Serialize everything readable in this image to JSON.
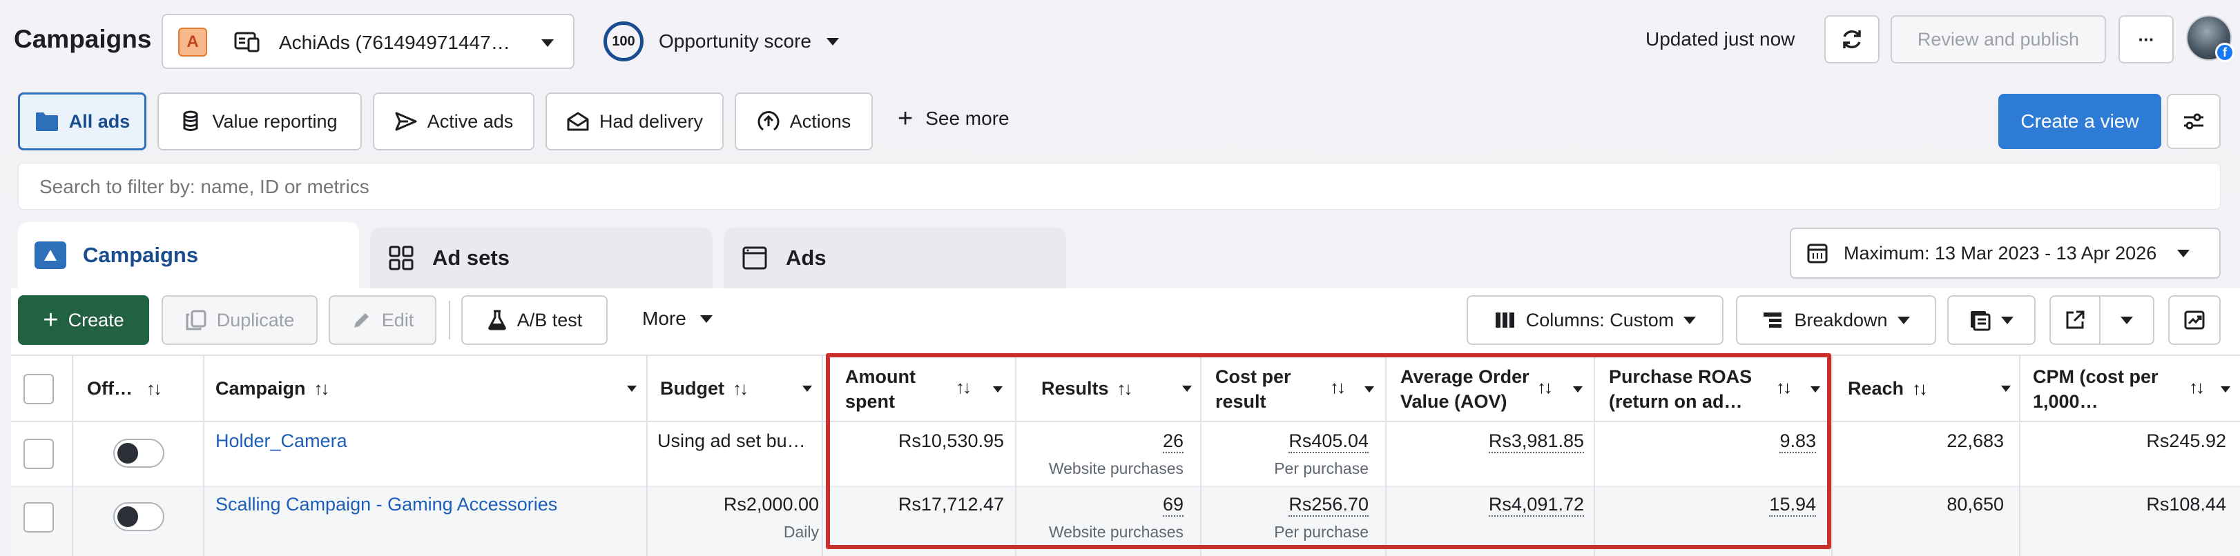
{
  "header": {
    "title": "Campaigns",
    "account_letter": "A",
    "account_name": "AchiAds (761494971447…",
    "opportunity_score": "100",
    "opportunity_label": "Opportunity score",
    "updated": "Updated just now",
    "review_publish": "Review and publish",
    "more": "···"
  },
  "views": {
    "items": [
      "All ads",
      "Value reporting",
      "Active ads",
      "Had delivery",
      "Actions"
    ],
    "see_more": "See more",
    "create_view": "Create a view"
  },
  "search": {
    "placeholder": "Search to filter by: name, ID or metrics"
  },
  "tabs": [
    "Campaigns",
    "Ad sets",
    "Ads"
  ],
  "date_range": "Maximum: 13 Mar 2023 - 13 Apr 2026",
  "toolbar": {
    "create": "Create",
    "duplicate": "Duplicate",
    "edit": "Edit",
    "ab_test": "A/B test",
    "more": "More",
    "columns": "Columns: Custom",
    "breakdown": "Breakdown"
  },
  "table": {
    "headers": {
      "off_on": "Off…",
      "campaign": "Campaign",
      "budget": "Budget",
      "amount_spent": "Amount spent",
      "results": "Results",
      "cost_per_result": "Cost per result",
      "aov": "Average Order Value (AOV)",
      "roas": "Purchase ROAS (return on ad…",
      "reach": "Reach",
      "cpm": "CPM (cost per 1,000…"
    },
    "rows": [
      {
        "campaign": "Holder_Camera",
        "budget": "Using ad set bu…",
        "budget_sub": "",
        "amount_spent": "Rs10,530.95",
        "results": "26",
        "results_sub": "Website purchases",
        "cost_per_result": "Rs405.04",
        "cost_sub": "Per purchase",
        "aov": "Rs3,981.85",
        "roas": "9.83",
        "reach": "22,683",
        "cpm": "Rs245.92"
      },
      {
        "campaign": "Scalling Campaign - Gaming Accessories",
        "budget": "Rs2,000.00",
        "budget_sub": "Daily",
        "amount_spent": "Rs17,712.47",
        "results": "69",
        "results_sub": "Website purchases",
        "cost_per_result": "Rs256.70",
        "cost_sub": "Per purchase",
        "aov": "Rs4,091.72",
        "roas": "15.94",
        "reach": "80,650",
        "cpm": "Rs108.44"
      }
    ]
  },
  "colors": {
    "accent_blue": "#2d7bd4",
    "green": "#226142",
    "highlight_red": "#c9302c",
    "link": "#1d5fb8"
  }
}
